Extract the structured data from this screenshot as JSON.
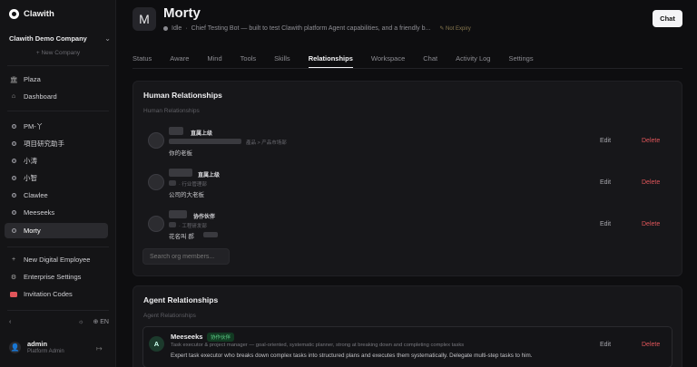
{
  "brand": {
    "name": "Clawith"
  },
  "company": {
    "name": "Clawith Demo Company",
    "new_label": "+ New Company"
  },
  "nav_top": [
    {
      "label": "Plaza",
      "icon": "bank-icon"
    },
    {
      "label": "Dashboard",
      "icon": "home-icon"
    }
  ],
  "agents": [
    {
      "label": "PM-丫"
    },
    {
      "label": "項目研究助手"
    },
    {
      "label": "小涛"
    },
    {
      "label": "小智"
    },
    {
      "label": "Clawlee"
    },
    {
      "label": "Meeseeks"
    },
    {
      "label": "Morty",
      "active": true
    }
  ],
  "nav_bottom": [
    {
      "label": "New Digital Employee"
    },
    {
      "label": "Enterprise Settings"
    },
    {
      "label": "Invitation Codes"
    }
  ],
  "sidebar_footer": {
    "lang": "EN"
  },
  "user": {
    "name": "admin",
    "role": "Platform Admin"
  },
  "agent": {
    "initial": "M",
    "name": "Morty",
    "status": "Idle",
    "bio": "Chief Testing Bot — built to test Clawith platform Agent capabilities, and a friendly b...",
    "expiry": "Not Expiry"
  },
  "chat_button": "Chat",
  "tabs": [
    "Status",
    "Aware",
    "Mind",
    "Tools",
    "Skills",
    "Relationships",
    "Workspace",
    "Chat",
    "Activity Log",
    "Settings"
  ],
  "active_tab": "Relationships",
  "human_section": {
    "title": "Human Relationships",
    "subtitle": "Human Relationships",
    "rows": [
      {
        "tag": "直属上级",
        "line2": "產品 > 产品市场部",
        "desc": "你的老板"
      },
      {
        "tag": "直属上级",
        "line2": "· 行业管理部",
        "desc": "公司的大老板"
      },
      {
        "tag": "协作伙伴",
        "line2": "· 工程研发部",
        "desc": "花名叫 郝"
      }
    ],
    "edit_label": "Edit",
    "delete_label": "Delete",
    "search_placeholder": "Search org members..."
  },
  "agent_section": {
    "title": "Agent Relationships",
    "subtitle": "Agent Relationships",
    "card": {
      "initial": "A",
      "name": "Meeseeks",
      "badge": "协作伙伴",
      "role": "Task executor & project manager — goal-oriented, systematic planner, strong at breaking down and completing complex tasks",
      "desc": "Expert task executor who breaks down complex tasks into structured plans and executes them systematically. Delegate multi-step tasks to him."
    }
  },
  "colors": {
    "delete": "#e0555a",
    "badge_green": "#5fd08a",
    "background": "#0e0e10"
  }
}
